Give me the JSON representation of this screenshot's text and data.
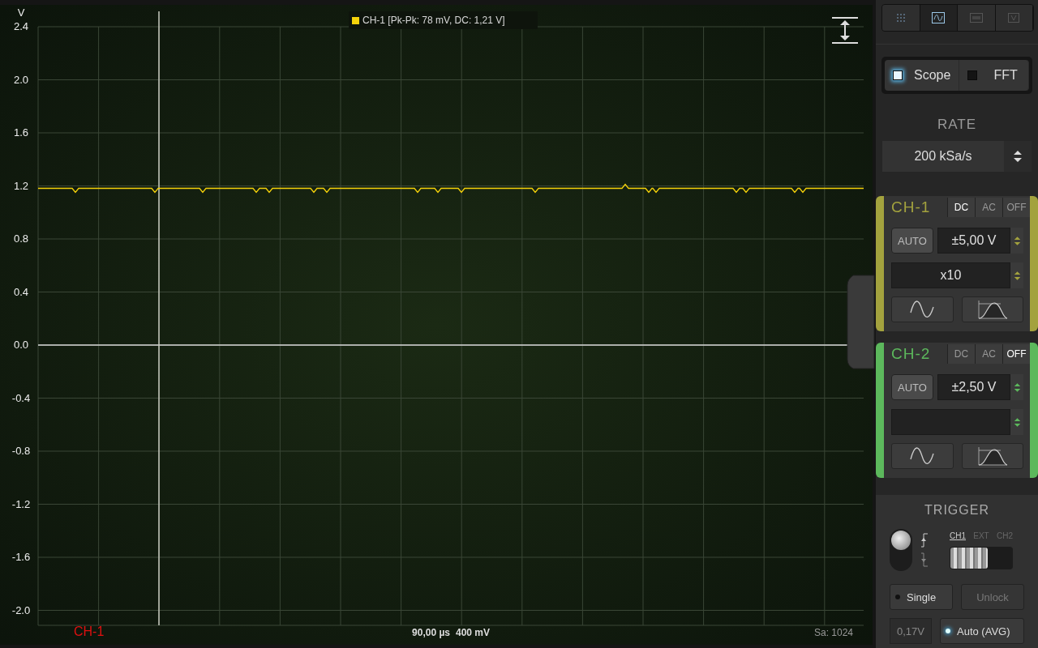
{
  "scope": {
    "legend": {
      "label": "CH-1 [Pk-Pk: 78 mV, DC: 1,21 V]",
      "color": "#f5d20a"
    },
    "y_unit": "V",
    "y_labels": [
      "2.4",
      "2.0",
      "1.6",
      "1.2",
      "0.8",
      "0.4",
      "0.0",
      "-0.4",
      "-0.8",
      "-1.2",
      "-1.6",
      "-2.0"
    ],
    "channel_label": "CH-1",
    "timebase": "90,00 µs",
    "volts_per_div": "400 mV",
    "samples": "Sa: 1024"
  },
  "view_tabs": [
    {
      "kind": "grid",
      "selected": false
    },
    {
      "kind": "wave",
      "selected": true
    },
    {
      "kind": "meter",
      "selected": false
    },
    {
      "kind": "volt",
      "selected": false
    }
  ],
  "modes": [
    {
      "label": "Scope",
      "selected": true
    },
    {
      "label": "FFT",
      "selected": false
    }
  ],
  "rate": {
    "label": "RATE",
    "value": "200 kSa/s"
  },
  "channels": [
    {
      "name": "CH-1",
      "color": "#a3a23e",
      "coupling": [
        {
          "label": "DC",
          "selected": true
        },
        {
          "label": "AC",
          "selected": false
        },
        {
          "label": "OFF",
          "selected": false
        }
      ],
      "auto": "AUTO",
      "range": "±5,00 V",
      "probe": "x10"
    },
    {
      "name": "CH-2",
      "color": "#5cb85c",
      "coupling": [
        {
          "label": "DC",
          "selected": false
        },
        {
          "label": "AC",
          "selected": false
        },
        {
          "label": "OFF",
          "selected": true
        }
      ],
      "auto": "AUTO",
      "range": "±2,50 V"
    }
  ],
  "trigger": {
    "title": "TRIGGER",
    "edges": [
      {
        "kind": "rising",
        "selected": true
      },
      {
        "kind": "falling",
        "selected": false
      }
    ],
    "sources": [
      {
        "label": "CH1",
        "selected": true
      },
      {
        "label": "EXT",
        "selected": false
      },
      {
        "label": "CH2",
        "selected": false
      }
    ],
    "single": {
      "label": "Single",
      "on": false
    },
    "unlock": {
      "label": "Unlock",
      "disabled": true
    },
    "level": "0,17V",
    "auto": {
      "label": "Auto (AVG)",
      "on": true
    }
  }
}
